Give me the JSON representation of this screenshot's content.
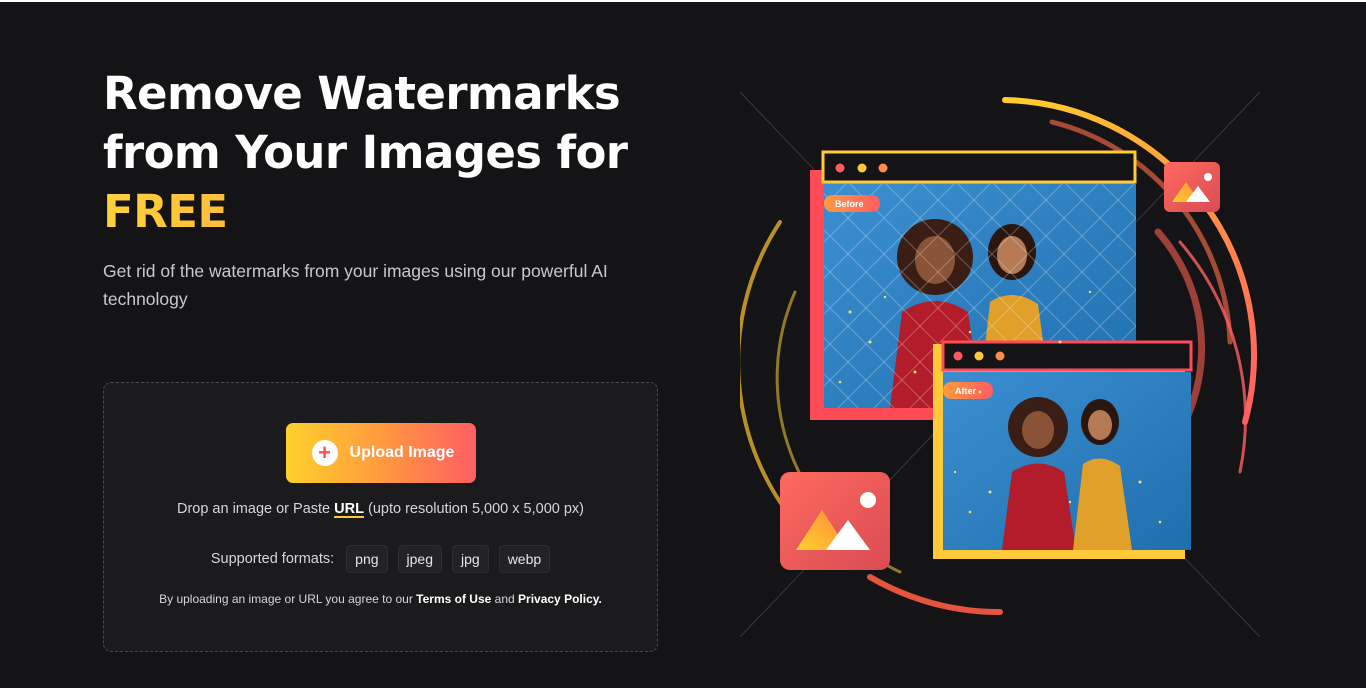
{
  "hero": {
    "title_line1": "Remove Watermarks",
    "title_line2": "from Your Images for",
    "title_highlight": "FREE",
    "subtitle": "Get rid of the watermarks from your images using our powerful AI technology"
  },
  "uploader": {
    "button_label": "Upload Image",
    "button_icon": "plus-icon",
    "drop_prefix": "Drop an image or Paste",
    "url_link": "URL",
    "drop_suffix": "(upto resolution 5,000 x 5,000 px)",
    "formats_label": "Supported formats:",
    "formats": [
      "png",
      "jpeg",
      "jpg",
      "webp"
    ],
    "terms_prefix": "By uploading an image or URL you agree to our",
    "terms_link": "Terms of Use",
    "terms_and": "and",
    "privacy_link": "Privacy Policy."
  },
  "illustration": {
    "before_badge": "Before",
    "after_badge": "After",
    "icons": [
      "image-icon",
      "image-icon"
    ]
  },
  "colors": {
    "background": "#141416",
    "accent_yellow": "#ffd12c",
    "accent_orange": "#ff9a3e",
    "accent_red": "#ff5e63",
    "photo_blue": "#2a86c8"
  }
}
